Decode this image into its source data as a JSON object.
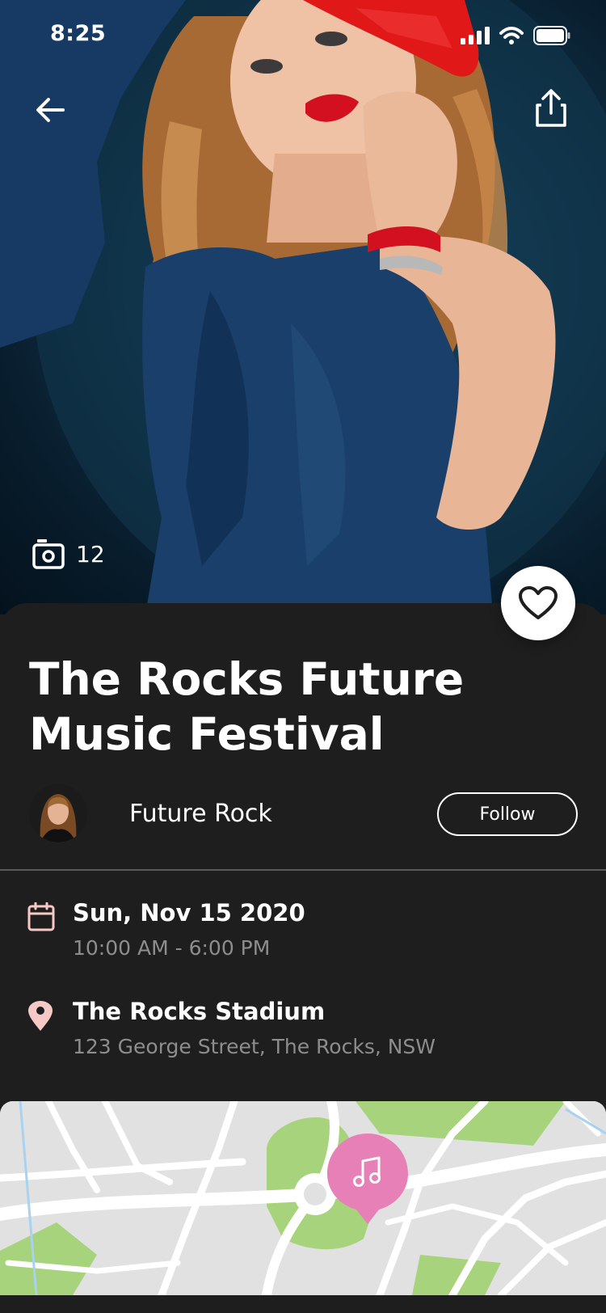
{
  "status_bar": {
    "time": "8:25",
    "icons": [
      "signal-icon",
      "wifi-icon",
      "battery-icon"
    ]
  },
  "hero": {
    "photo_count": "12",
    "icons": [
      "back-arrow-icon",
      "share-icon",
      "camera-icon"
    ]
  },
  "event": {
    "title": "The Rocks Future Music Festival",
    "favorite_icon": "heart-icon"
  },
  "organizer": {
    "name": "Future Rock",
    "follow_label": "Follow"
  },
  "details": {
    "date": "Sun, Nov 15 2020",
    "time_range": "10:00 AM - 6:00 PM",
    "venue": "The Rocks Stadium",
    "address": "123 George Street, The Rocks, NSW"
  },
  "map": {
    "pin_icon": "music-note-icon"
  },
  "colors": {
    "background": "#1e1e1e",
    "accent_pink": "#e680b6",
    "icon_pink": "#f6c9c6",
    "map_green": "#a7d37c",
    "muted_text": "#8d8d8d"
  }
}
